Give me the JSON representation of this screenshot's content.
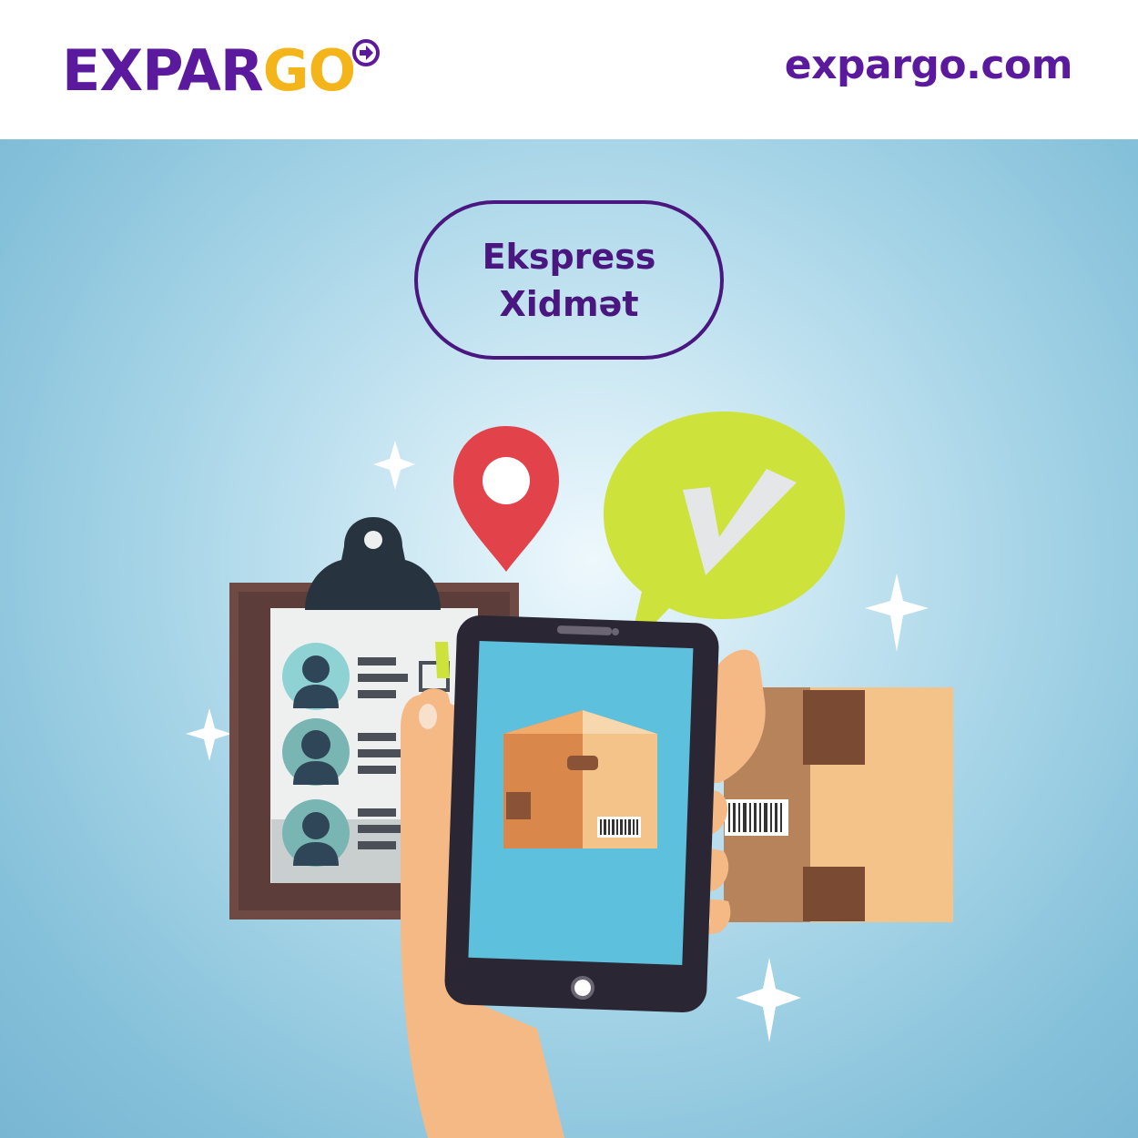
{
  "header": {
    "logo": {
      "part1": "EXPAR",
      "part2": "GO"
    },
    "site_url": "expargo.com"
  },
  "badge": {
    "line1": "Ekspress",
    "line2": "Xidmət"
  },
  "colors": {
    "brand_purple": "#5b1a9e",
    "brand_yellow": "#f4b51a",
    "badge_border": "#4a1680",
    "check_bubble": "#cde23b",
    "location_pin": "#e2434b"
  },
  "icons": [
    "logo-arrow-icon",
    "location-pin-icon",
    "check-bubble-icon",
    "clipboard-icon",
    "smartphone-icon",
    "parcel-box-icon",
    "sparkle-icon"
  ]
}
